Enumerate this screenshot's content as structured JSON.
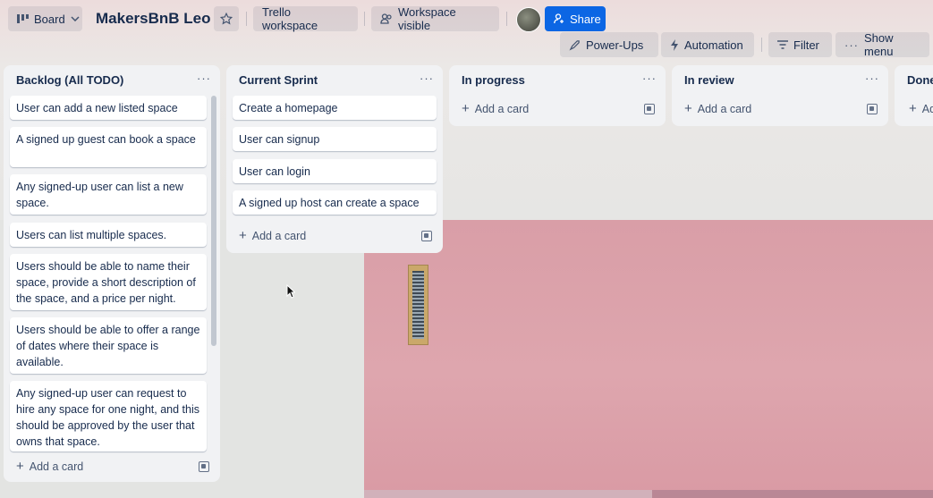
{
  "header": {
    "board_switcher": "Board",
    "title": "MakersBnB Leo",
    "workspace": "Trello workspace",
    "visibility": "Workspace visible",
    "share": "Share",
    "powerups": "Power-Ups",
    "automation": "Automation",
    "filter": "Filter",
    "show_menu": "Show menu"
  },
  "lists": [
    {
      "title": "Backlog (All TODO)",
      "cards": [
        "User can add a new listed space",
        "A signed up guest can book a space",
        "Any signed-up user can list a new space.",
        "Users can list multiple spaces.",
        "Users should be able to name their space, provide a short description of the space, and a price per night.",
        "Users should be able to offer a range of dates where their space is available.",
        "Any signed-up user can request to hire any space for one night, and this should be approved by the user that owns that space."
      ],
      "add_card": "Add a card"
    },
    {
      "title": "Current Sprint",
      "cards": [
        "Create a homepage",
        "User can signup",
        "User can login",
        "A signed up host can create a space"
      ],
      "add_card": "Add a card"
    },
    {
      "title": "In progress",
      "add_card": "Add a card"
    },
    {
      "title": "In review",
      "add_card": "Add a card"
    },
    {
      "title": "Done",
      "add_card": "Ad"
    }
  ],
  "colors": {
    "accent": "#0c66e4",
    "wall": "#dea6ae"
  }
}
